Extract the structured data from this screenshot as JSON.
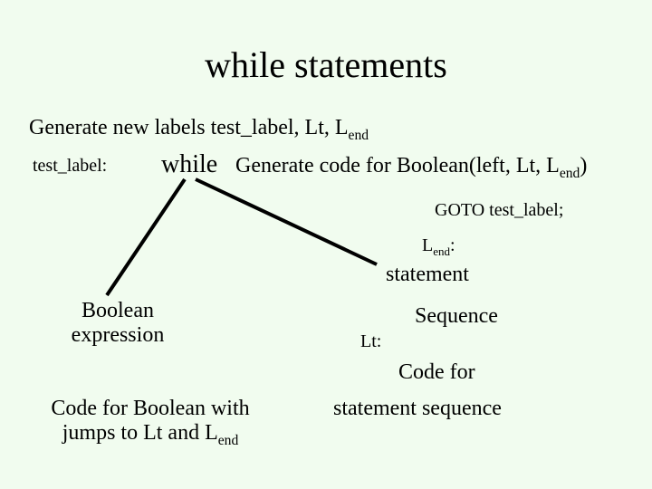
{
  "title": "while statements",
  "gen_labels_prefix": "Generate new labels test_label, Lt, L",
  "gen_labels_sub": "end",
  "test_label": "test_label:",
  "while": "while",
  "gen_bool_prefix": "Generate code for Boolean(left, Lt, L",
  "gen_bool_sub": "end",
  "gen_bool_suffix": ")",
  "goto": "GOTO test_label;",
  "L_end_prefix": "L",
  "L_end_sub": "end",
  "L_end_suffix": ":",
  "statement": "statement",
  "boolean_expr_line1": "Boolean",
  "boolean_expr_line2": "expression",
  "sequence": "Sequence",
  "Lt": "Lt:",
  "code_for": "Code for",
  "stmt_seq": "statement sequence",
  "code_bool_line1": "Code for Boolean with",
  "code_bool_line2_prefix": "jumps to Lt and L",
  "code_bool_line2_sub": "end"
}
